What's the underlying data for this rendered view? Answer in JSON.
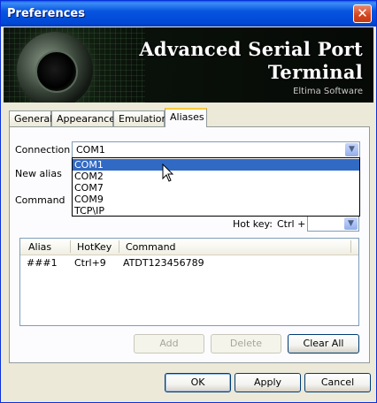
{
  "window": {
    "title": "Preferences",
    "close_symbol": "✕"
  },
  "banner": {
    "title_line1": "Advanced Serial Port",
    "title_line2": "Terminal",
    "vendor": "Eltima Software"
  },
  "tabs": [
    {
      "label": "General"
    },
    {
      "label": "Appearance"
    },
    {
      "label": "Emulation"
    },
    {
      "label": "Aliases",
      "active": true
    }
  ],
  "form": {
    "connection_label": "Connection",
    "connection_value": "COM1",
    "new_alias_label": "New alias",
    "command_label": "Command",
    "hotkey_label": "Hot key:",
    "hotkey_prefix": "Ctrl +",
    "hotkey_value": ""
  },
  "connection_dropdown": {
    "options": [
      "COM1",
      "COM2",
      "COM7",
      "COM9",
      "TCP\\IP"
    ],
    "highlighted": "COM1"
  },
  "aliases_table": {
    "columns": [
      "Alias",
      "HotKey",
      "Command"
    ],
    "rows": [
      {
        "alias": "###1",
        "hotkey": "Ctrl+9",
        "command": "ATDT123456789"
      }
    ]
  },
  "panel_buttons": {
    "add": "Add",
    "delete": "Delete",
    "clear_all": "Clear All"
  },
  "dialog_buttons": {
    "ok": "OK",
    "apply": "Apply",
    "cancel": "Cancel"
  },
  "icons": {
    "dropdown_arrow": "chevron-down-icon",
    "close": "close-icon",
    "cursor": "mouse-pointer-icon"
  }
}
